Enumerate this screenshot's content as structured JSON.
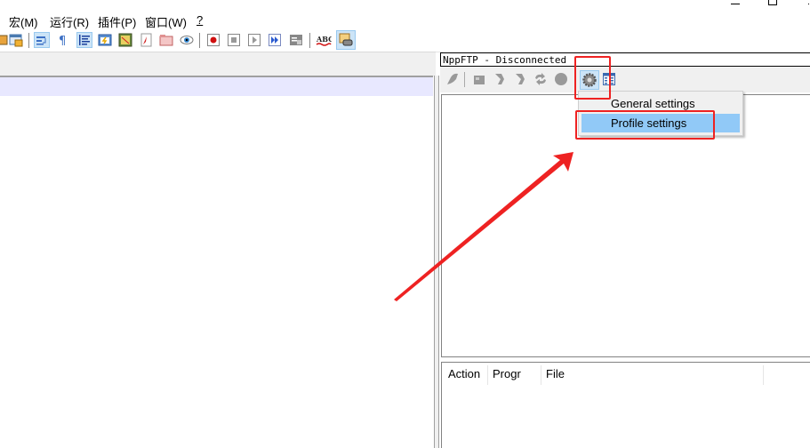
{
  "window": {
    "controls": [
      "minimize",
      "restore",
      "close"
    ]
  },
  "menubar": {
    "items": [
      {
        "label": "宏(M)"
      },
      {
        "label": "运行(R)"
      },
      {
        "label": "插件(P)"
      },
      {
        "label": "窗口(W)"
      },
      {
        "label": "?"
      }
    ]
  },
  "toolbar": {
    "icons": [
      "save-all-icon",
      "lock-icon",
      "word-wrap-icon",
      "show-all-chars-icon",
      "indent-guide-icon",
      "user-lang-icon",
      "doc-map-icon",
      "function-list-icon",
      "folder-workspace-icon",
      "monitor-icon",
      "record-macro-icon",
      "stop-record-icon",
      "play-macro-icon",
      "run-macro-multiple-icon",
      "save-macro-icon",
      "spell-check-icon",
      "nppftp-show-icon"
    ],
    "spell_check_text": "ABC"
  },
  "nppftp": {
    "title": "NppFTP - Disconnected",
    "toolbar_icons": [
      "connect-icon",
      "download-icon",
      "upload-icon",
      "refresh-icon",
      "sync-icon",
      "abort-icon",
      "settings-icon",
      "message-window-icon"
    ],
    "settings_menu": {
      "items": [
        {
          "label": "General settings",
          "highlighted": false
        },
        {
          "label": "Profile settings",
          "highlighted": true
        }
      ]
    },
    "queue": {
      "columns": [
        "Action",
        "Progr",
        "File"
      ]
    }
  },
  "annotation": {
    "color": "#ee2222"
  }
}
